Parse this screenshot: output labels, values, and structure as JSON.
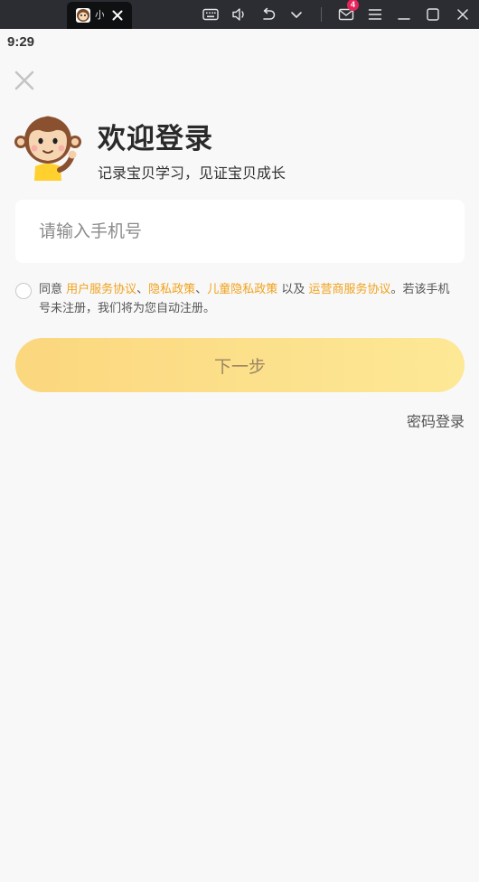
{
  "window": {
    "tab_title": "小",
    "mail_badge_count": "4",
    "icons": [
      "keyboard-icon",
      "volume-icon",
      "undo-icon",
      "chevron-down-icon",
      "mail-icon",
      "menu-icon",
      "minimize-icon",
      "maximize-icon",
      "close-icon"
    ]
  },
  "status_bar": {
    "time": "9:29"
  },
  "login": {
    "title": "欢迎登录",
    "subtitle": "记录宝贝学习，见证宝贝成长",
    "phone_placeholder": "请输入手机号",
    "phone_value": "",
    "agreement": {
      "prefix": "同意 ",
      "link_user": "用户服务协议",
      "sep1": "、",
      "link_privacy": "隐私政策",
      "sep2": "、",
      "link_child_privacy": "儿童隐私政策",
      "mid": " 以及 ",
      "link_operator": "运营商服务协议",
      "suffix": "。若该手机号未注册，我们将为您自动注册。"
    },
    "next_label": "下一步",
    "password_login_label": "密码登录"
  },
  "colors": {
    "accent": "#f0a21c",
    "button_start": "#fbd77e",
    "button_end": "#fde896",
    "badge": "#e6245a"
  }
}
